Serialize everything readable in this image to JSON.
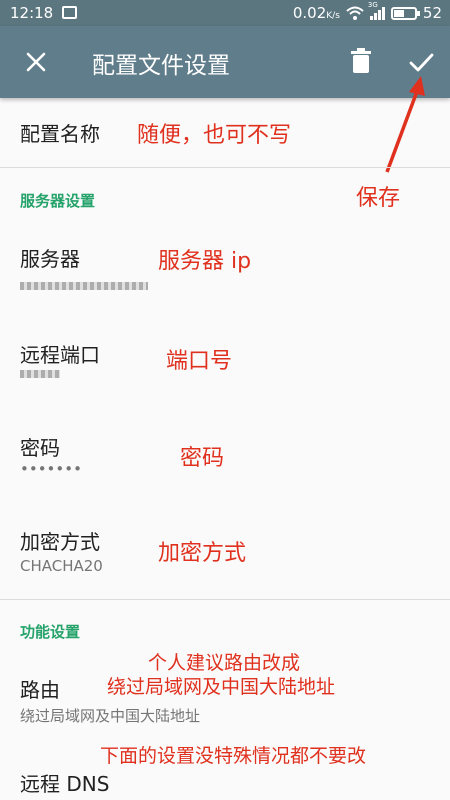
{
  "status_bar": {
    "time": "12:18",
    "network_speed": "0.02",
    "network_speed_unit": "K/s",
    "signal_tag": "3G",
    "battery": "52"
  },
  "toolbar": {
    "title": "配置文件设置"
  },
  "settings": {
    "profile_name_label": "配置名称",
    "server_section": "服务器设置",
    "server_label": "服务器",
    "remote_port_label": "远程端口",
    "password_label": "密码",
    "password_value": "•••••••",
    "encryption_label": "加密方式",
    "encryption_value": "CHACHA20",
    "function_section": "功能设置",
    "route_label": "路由",
    "route_value": "绕过局域网及中国大陆地址",
    "remote_dns_label": "远程 DNS"
  },
  "annotations": {
    "profile_name": "随便，也可不写",
    "save": "保存",
    "server": "服务器 ip",
    "port": "端口号",
    "password": "密码",
    "encryption": "加密方式",
    "route_line1": "个人建议路由改成",
    "route_line2": "绕过局域网及中国大陆地址",
    "bottom_note": "下面的设置没特殊情况都不要改"
  },
  "colors": {
    "toolbar": "#607d8b",
    "status_bar": "#5c7680",
    "section_header": "#26a36b",
    "annotation": "#e0301e"
  }
}
